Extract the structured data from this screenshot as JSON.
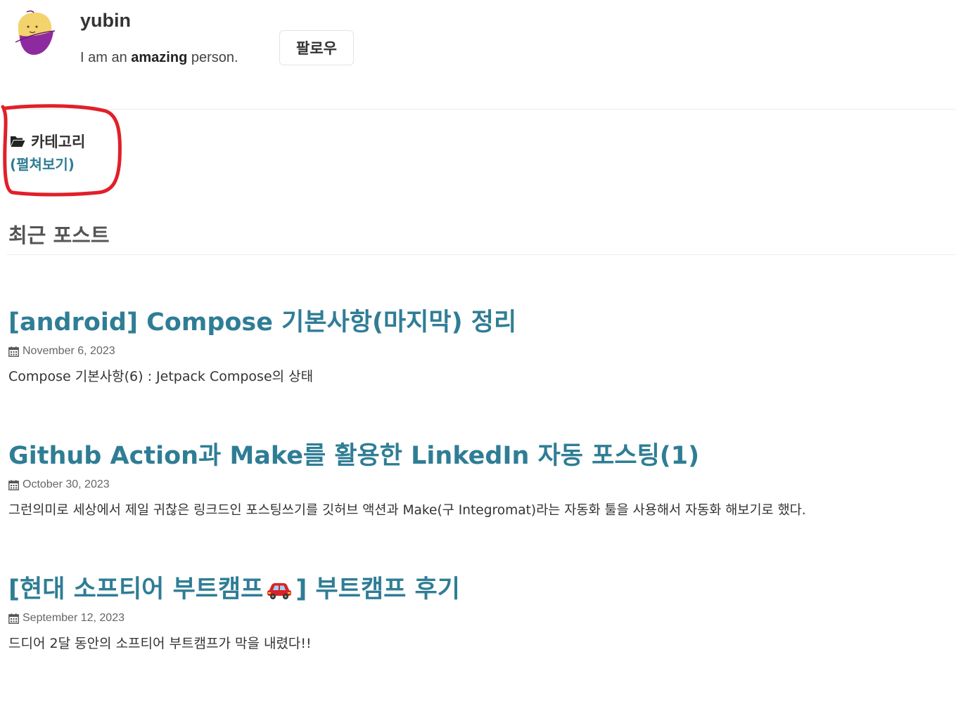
{
  "profile": {
    "name": "yubin",
    "bio_prefix": "I am an ",
    "bio_emphasis": "amazing",
    "bio_suffix": " person.",
    "follow_label": "팔로우"
  },
  "category": {
    "title": "카테고리",
    "expand_label": "(펼쳐보기)",
    "icon": "folder-open-icon"
  },
  "recent": {
    "title": "최근 포스트"
  },
  "posts": [
    {
      "title": "[android] Compose 기본사항(마지막) 정리",
      "date": "November 6, 2023",
      "excerpt": "Compose 기본사항(6) : Jetpack Compose의 상태"
    },
    {
      "title": "Github Action과 Make를 활용한 LinkedIn 자동 포스팅(1)",
      "date": "October 30, 2023",
      "excerpt": "그런의미로 세상에서 제일 귀찮은 링크드인 포스팅쓰기를 깃허브 액션과 Make(구 Integromat)라는 자동화 툴을 사용해서 자동화 해보기로 했다."
    },
    {
      "title_prefix": "[현대 소프티어 부트캠프",
      "title_suffix": "] 부트캠프 후기",
      "title_icon": "car-icon",
      "date": "September 12, 2023",
      "excerpt": "드디어 2달 동안의 소프티어 부트캠프가 막을 내렸다!!"
    }
  ],
  "colors": {
    "link": "#2f7d95",
    "annotation": "#e0202a",
    "avatar_face": "#f3d36b",
    "avatar_body": "#8e2aa0"
  }
}
